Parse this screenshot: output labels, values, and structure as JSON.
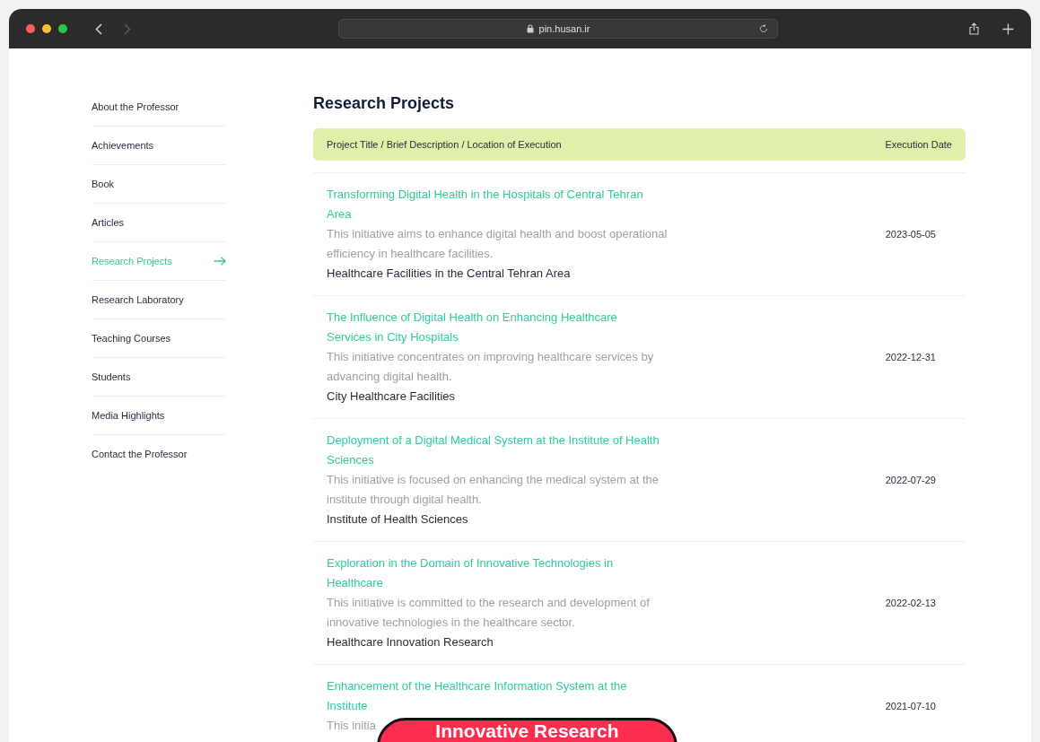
{
  "browser": {
    "url": "pin.husan.ir",
    "back_disabled": false,
    "forward_disabled": true
  },
  "sidebar": {
    "items": [
      {
        "label": "About the Professor",
        "selected": false
      },
      {
        "label": "Achievements",
        "selected": false
      },
      {
        "label": "Book",
        "selected": false
      },
      {
        "label": "Articles",
        "selected": false
      },
      {
        "label": "Research Projects",
        "selected": true
      },
      {
        "label": "Research Laboratory",
        "selected": false
      },
      {
        "label": "Teaching Courses",
        "selected": false
      },
      {
        "label": "Students",
        "selected": false
      },
      {
        "label": "Media Highlights",
        "selected": false
      },
      {
        "label": "Contact the Professor",
        "selected": false
      }
    ]
  },
  "heading": "Research Projects",
  "table": {
    "columns": [
      "Project Title / Brief Description / Location of Execution",
      "Execution Date"
    ],
    "rows": [
      {
        "title": "Transforming Digital Health in the Hospitals of Central Tehran Area",
        "description": "This initiative aims to enhance digital health and boost operational efficiency in healthcare facilities.",
        "location": "Healthcare Facilities in the Central Tehran Area",
        "date": "2023-05-05"
      },
      {
        "title": "The Influence of Digital Health on Enhancing Healthcare Services in City Hospitals",
        "description": "This initiative concentrates on improving healthcare services by advancing digital health.",
        "location": "City Healthcare Facilities",
        "date": "2022-12-31"
      },
      {
        "title": "Deployment of a Digital Medical System at the Institute of Health Sciences",
        "description": "This initiative is focused on enhancing the medical system at the institute through digital health.",
        "location": "Institute of Health Sciences",
        "date": "2022-07-29"
      },
      {
        "title": "Exploration in the Domain of Innovative Technologies in Healthcare",
        "description": "This initiative is committed to the research and development of innovative technologies in the healthcare sector.",
        "location": "Healthcare Innovation Research",
        "date": "2022-02-13"
      },
      {
        "title": "Enhancement of the Healthcare Information System at the Institute",
        "description": "This initia",
        "date": "2021-07-10"
      }
    ]
  },
  "badge": "Innovative Research"
}
